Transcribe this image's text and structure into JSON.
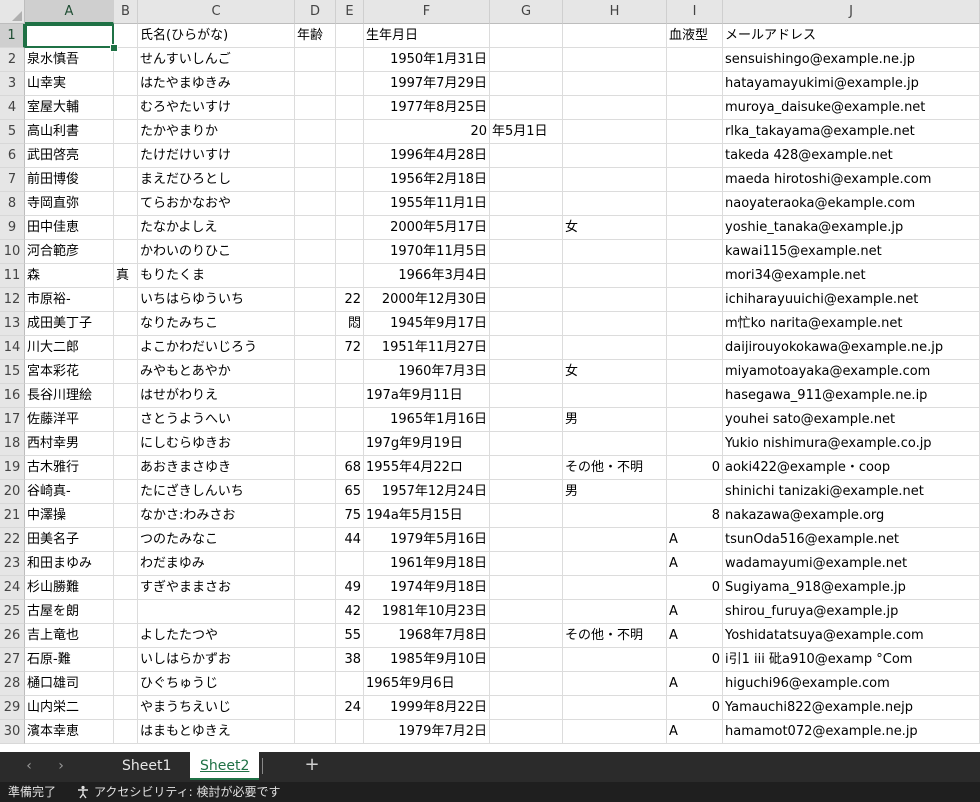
{
  "columns": [
    "A",
    "B",
    "C",
    "D",
    "E",
    "F",
    "G",
    "H",
    "I",
    "J"
  ],
  "active_column": "A",
  "active_row": "1",
  "rows": [
    {
      "n": "1",
      "A": "",
      "B": "",
      "C": "氏名(ひらがな)",
      "D": "年齢",
      "E": "",
      "F": "生年月日",
      "G": "",
      "H": "",
      "I": "血液型",
      "J": "メールアドレス"
    },
    {
      "n": "2",
      "A": "泉水慎吾",
      "B": "",
      "C": "せんすいしんご",
      "D": "",
      "E": "",
      "F": "1950年1月31日",
      "G": "",
      "H": "",
      "I": "",
      "J": "sensuishingo@example.ne.jp"
    },
    {
      "n": "3",
      "A": "山幸実",
      "B": "",
      "C": "はたやまゆきみ",
      "D": "",
      "E": "",
      "F": "1997年7月29日",
      "G": "",
      "H": "",
      "I": "",
      "J": "hatayamayukimi@example.jp"
    },
    {
      "n": "4",
      "A": "室屋大輔",
      "B": "",
      "C": "むろやたいすけ",
      "D": "",
      "E": "",
      "F": "1977年8月25日",
      "G": "",
      "H": "",
      "I": "",
      "J": "muroya_daisuke@example.net"
    },
    {
      "n": "5",
      "A": "高山利書",
      "B": "",
      "C": "たかやまりか",
      "D": "",
      "E": "",
      "F": "20",
      "G": "年5月1日",
      "H": "",
      "I": "",
      "J": "rlka_takayama@example.net"
    },
    {
      "n": "6",
      "A": "武田啓亮",
      "B": "",
      "C": "たけだけいすけ",
      "D": "",
      "E": "",
      "F": "1996年4月28日",
      "G": "",
      "H": "",
      "I": "",
      "J": "takeda 428@example.net"
    },
    {
      "n": "7",
      "A": "前田博俊",
      "B": "",
      "C": "まえだひろとし",
      "D": "",
      "E": "",
      "F": "1956年2月18日",
      "G": "",
      "H": "",
      "I": "",
      "J": "maeda hirotoshi@example.com"
    },
    {
      "n": "8",
      "A": "寺岡直弥",
      "B": "",
      "C": "てらおかなおや",
      "D": "",
      "E": "",
      "F": "1955年11月1日",
      "G": "",
      "H": "",
      "I": "",
      "J": "naoyateraoka@ekample.com"
    },
    {
      "n": "9",
      "A": "田中佳恵",
      "B": "",
      "C": "たなかよしえ",
      "D": "",
      "E": "",
      "F": "2000年5月17日",
      "G": "",
      "H": "女",
      "I": "",
      "J": "yoshie_tanaka@example.jp"
    },
    {
      "n": "10",
      "A": "河合範彦",
      "B": "",
      "C": "かわいのりひこ",
      "D": "",
      "E": "",
      "F": "1970年11月5日",
      "G": "",
      "H": "",
      "I": "",
      "J": "kawai115@example.net"
    },
    {
      "n": "11",
      "A": "森",
      "B": "真",
      "C": "もりたくま",
      "D": "",
      "E": "",
      "F": "1966年3月4日",
      "G": "",
      "H": "",
      "I": "",
      "J": "mori34@example.net"
    },
    {
      "n": "12",
      "A": "市原裕-",
      "B": "",
      "C": "いちはらゆういち",
      "D": "",
      "E": "22",
      "F": "2000年12月30日",
      "G": "",
      "H": "",
      "I": "",
      "J": "ichiharayuuichi@example.net"
    },
    {
      "n": "13",
      "A": "成田美丁子",
      "B": "",
      "C": "なりたみちこ",
      "D": "",
      "E": "悶",
      "F": "1945年9月17日",
      "G": "",
      "H": "",
      "I": "",
      "J": "m忙ko narita@example.net"
    },
    {
      "n": "14",
      "A": "川大二郎",
      "B": "",
      "C": "よこかわだいじろう",
      "D": "",
      "E": "72",
      "F": "1951年11月27日",
      "G": "",
      "H": "",
      "I": "",
      "J": "daijirouyokokawa@example.ne.jp"
    },
    {
      "n": "15",
      "A": "宮本彩花",
      "B": "",
      "C": "みやもとあやか",
      "D": "",
      "E": "",
      "F": "1960年7月3日",
      "G": "",
      "H": "女",
      "I": "",
      "J": "miyamotoayaka@example.com"
    },
    {
      "n": "16",
      "A": "長谷川理絵",
      "B": "",
      "C": "はせがわりえ",
      "D": "",
      "E": "",
      "F": "197a年9月11日",
      "G": "",
      "H": "",
      "I": "",
      "J": "hasegawa_911@example.ne.ip"
    },
    {
      "n": "17",
      "A": "佐藤洋平",
      "B": "",
      "C": "さとうようへい",
      "D": "",
      "E": "",
      "F": "1965年1月16日",
      "G": "",
      "H": "男",
      "I": "",
      "J": "youhei sato@example.net"
    },
    {
      "n": "18",
      "A": "西村幸男",
      "B": "",
      "C": "にしむらゆきお",
      "D": "",
      "E": "",
      "F": "197g年9月19日",
      "G": "",
      "H": "",
      "I": "",
      "J": "Yukio nishimura@example.co.jp"
    },
    {
      "n": "19",
      "A": "古木雅行",
      "B": "",
      "C": "あおきまさゆき",
      "D": "",
      "E": "68",
      "F": "1955年4月22ロ",
      "G": "",
      "H": "その他・不明",
      "I": "0",
      "J": "aoki422@example・coop"
    },
    {
      "n": "20",
      "A": "谷崎真-",
      "B": "",
      "C": "たにざきしんいち",
      "D": "",
      "E": "65",
      "F": "1957年12月24日",
      "G": "",
      "H": "男",
      "I": "",
      "J": "shinichi tanizaki@example.net"
    },
    {
      "n": "21",
      "A": "中澤操",
      "B": "",
      "C": "なかさ:わみさお",
      "D": "",
      "E": "75",
      "F": "194a年5月15日",
      "G": "",
      "H": "",
      "I": "8",
      "J": "nakazawa@example.org"
    },
    {
      "n": "22",
      "A": "田美名子",
      "B": "",
      "C": "つのたみなこ",
      "D": "",
      "E": "44",
      "F": "1979年5月16日",
      "G": "",
      "H": "",
      "I": "A",
      "J": "tsunOda516@example.net"
    },
    {
      "n": "23",
      "A": "和田まゆみ",
      "B": "",
      "C": "わだまゆみ",
      "D": "",
      "E": "",
      "F": "1961年9月18日",
      "G": "",
      "H": "",
      "I": "A",
      "J": "wadamayumi@example.net"
    },
    {
      "n": "24",
      "A": "杉山勝難",
      "B": "",
      "C": "すぎやままさお",
      "D": "",
      "E": "49",
      "F": "1974年9月18日",
      "G": "",
      "H": "",
      "I": "0",
      "J": "Sugiyama_918@example.jp"
    },
    {
      "n": "25",
      "A": "古屋を朗",
      "B": "",
      "C": "",
      "D": "",
      "E": "42",
      "F": "1981年10月23日",
      "G": "",
      "H": "",
      "I": "A",
      "J": "shirou_furuya@example.jp"
    },
    {
      "n": "26",
      "A": "吉上竜也",
      "B": "",
      "C": "よしたたつや",
      "D": "",
      "E": "55",
      "F": "1968年7月8日",
      "G": "",
      "H": "その他・不明",
      "I": "A",
      "J": "Yoshidatatsuya@example.com"
    },
    {
      "n": "27",
      "A": "石原-難",
      "B": "",
      "C": "いしはらかずお",
      "D": "",
      "E": "38",
      "F": "1985年9月10日",
      "G": "",
      "H": "",
      "I": "0",
      "J": "i引1 iii 砒a910@examp °Com"
    },
    {
      "n": "28",
      "A": "樋口雄司",
      "B": "",
      "C": "ひぐちゅうじ",
      "D": "",
      "E": "",
      "F": "1965年9月6日",
      "G": "",
      "H": "",
      "I": "A",
      "J": "higuchi96@example.com"
    },
    {
      "n": "29",
      "A": "山内栄二",
      "B": "",
      "C": "やまうちえいじ",
      "D": "",
      "E": "24",
      "F": "1999年8月22日",
      "G": "",
      "H": "",
      "I": "0",
      "J": "Yamauchi822@example.nejp"
    },
    {
      "n": "30",
      "A": "濱本幸恵",
      "B": "",
      "C": "はまもとゆきえ",
      "D": "",
      "E": "",
      "F": "1979年7月2日",
      "G": "",
      "H": "",
      "I": "A",
      "J": "hamamot072@example.ne.jp"
    }
  ],
  "sheets": [
    "Sheet1",
    "Sheet2"
  ],
  "active_sheet": "Sheet2",
  "add_sheet_label": "+",
  "nav": {
    "prev": "‹",
    "next": "›"
  },
  "status": {
    "ready": "準備完了",
    "accessibility": "アクセシビリティ: 検討が必要です"
  },
  "colors": {
    "accent": "#1f7145",
    "tab_bar": "#2b2b2b",
    "status_bar": "#1f1f1f"
  }
}
